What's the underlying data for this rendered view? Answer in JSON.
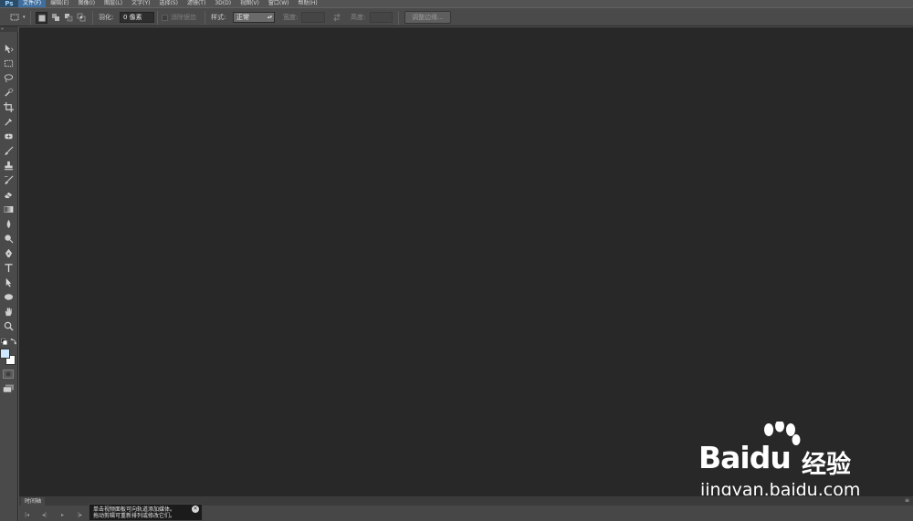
{
  "app": {
    "logo": "Ps"
  },
  "menu": [
    {
      "label": "文件(F)",
      "active": true
    },
    {
      "label": "编辑(E)"
    },
    {
      "label": "图像(I)"
    },
    {
      "label": "图层(L)"
    },
    {
      "label": "文字(Y)"
    },
    {
      "label": "选择(S)"
    },
    {
      "label": "滤镜(T)"
    },
    {
      "label": "3D(D)"
    },
    {
      "label": "视图(V)"
    },
    {
      "label": "窗口(W)"
    },
    {
      "label": "帮助(H)"
    }
  ],
  "options": {
    "feather_label": "羽化:",
    "feather_value": "0 像素",
    "antialias_label": "消除锯齿",
    "style_label": "样式:",
    "style_value": "正常",
    "width_label": "宽度:",
    "height_label": "高度:",
    "refine_edge_button": "调整边缘..."
  },
  "toolbar": {
    "grip": "»",
    "tools": [
      "move-icon",
      "rectangular-marquee-icon",
      "lasso-icon",
      "quick-selection-icon",
      "crop-icon",
      "eyedropper-icon",
      "spot-healing-icon",
      "brush-icon",
      "clone-stamp-icon",
      "history-brush-icon",
      "eraser-icon",
      "gradient-icon",
      "blur-icon",
      "dodge-icon",
      "pen-icon",
      "type-icon",
      "path-selection-icon",
      "ellipse-icon",
      "hand-icon",
      "zoom-icon"
    ],
    "foreground_color": "#cfe8ff",
    "background_color": "#ffffff"
  },
  "timeline": {
    "tab_label": "时间轴",
    "menu_icon": "≡"
  },
  "tooltip": {
    "line1": "单击视频面板可向轨道添加媒体。",
    "line2": "拖动剪辑可重新排列或修改它们。"
  },
  "watermark": {
    "brand_bai": "Bai",
    "brand_du": "du",
    "brand_cn": "经验",
    "url": "jingyan.baidu.com"
  },
  "colors": {
    "workspace": "#282828",
    "panel": "#4a4a4a",
    "accent": "#3f6f9f"
  }
}
